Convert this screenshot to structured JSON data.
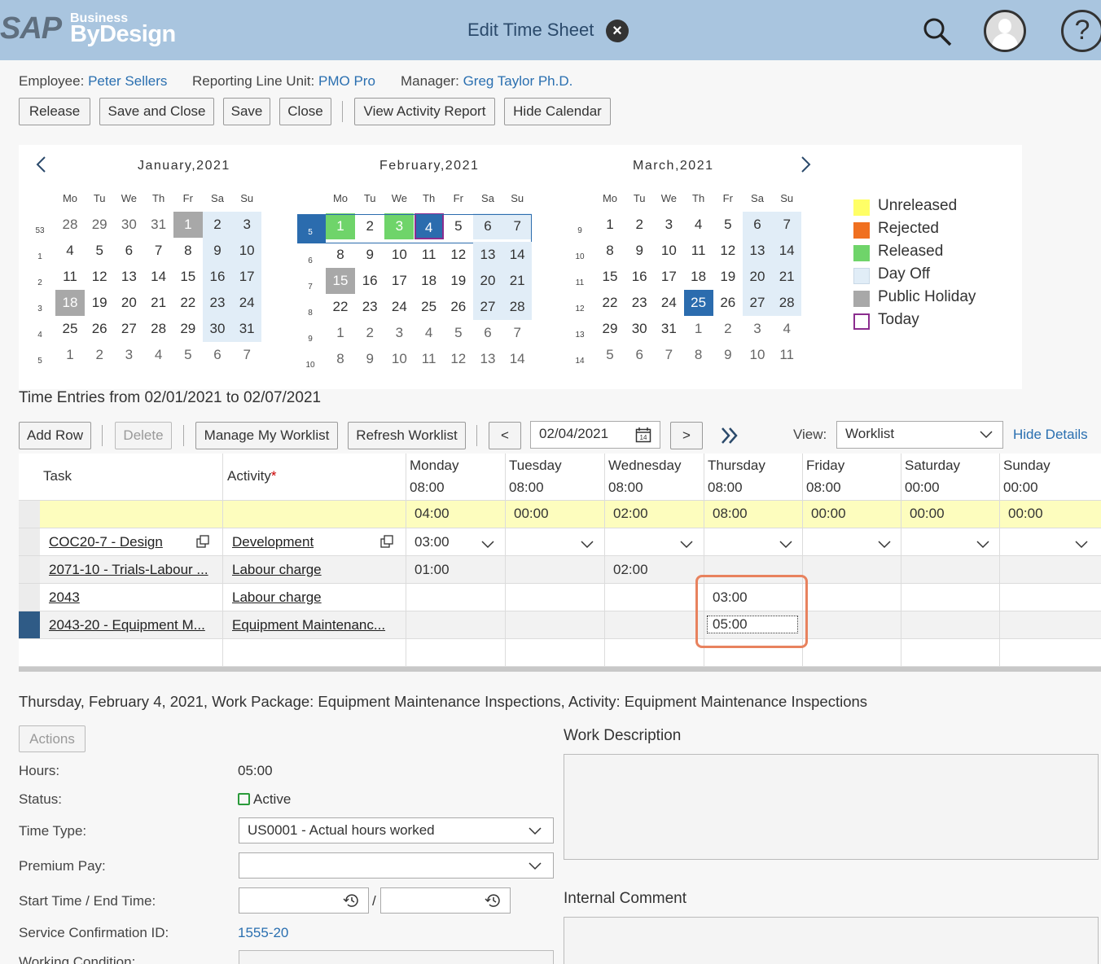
{
  "shell": {
    "logo_sap": "SAP",
    "logo_business": "Business",
    "logo_bydesign": "ByDesign",
    "title": "Edit Time Sheet",
    "close_icon": "×",
    "help_icon": "?"
  },
  "header": {
    "employee_label": "Employee:",
    "employee_value": "Peter Sellers",
    "rlu_label": "Reporting Line Unit:",
    "rlu_value": "PMO Pro",
    "manager_label": "Manager:",
    "manager_value": "Greg Taylor Ph.D."
  },
  "toolbar": {
    "release": "Release",
    "save_close": "Save and Close",
    "save": "Save",
    "close": "Close",
    "view_activity": "View Activity Report",
    "hide_calendar": "Hide Calendar"
  },
  "calendar": {
    "dow": [
      "Mo",
      "Tu",
      "We",
      "Th",
      "Fr",
      "Sa",
      "Su"
    ],
    "months": [
      {
        "title": "January,2021",
        "weeks": [
          "53",
          "1",
          "2",
          "3",
          "4",
          "5"
        ],
        "days": [
          [
            "28",
            "29",
            "30",
            "31",
            "1",
            "2",
            "3"
          ],
          [
            "4",
            "5",
            "6",
            "7",
            "8",
            "9",
            "10"
          ],
          [
            "11",
            "12",
            "13",
            "14",
            "15",
            "16",
            "17"
          ],
          [
            "18",
            "19",
            "20",
            "21",
            "22",
            "23",
            "24"
          ],
          [
            "25",
            "26",
            "27",
            "28",
            "29",
            "30",
            "31"
          ],
          [
            "1",
            "2",
            "3",
            "4",
            "5",
            "6",
            "7"
          ]
        ]
      },
      {
        "title": "February,2021",
        "weeks": [
          "5",
          "6",
          "7",
          "8",
          "9",
          "10"
        ],
        "days": [
          [
            "1",
            "2",
            "3",
            "4",
            "5",
            "6",
            "7"
          ],
          [
            "8",
            "9",
            "10",
            "11",
            "12",
            "13",
            "14"
          ],
          [
            "15",
            "16",
            "17",
            "18",
            "19",
            "20",
            "21"
          ],
          [
            "22",
            "23",
            "24",
            "25",
            "26",
            "27",
            "28"
          ],
          [
            "1",
            "2",
            "3",
            "4",
            "5",
            "6",
            "7"
          ],
          [
            "8",
            "9",
            "10",
            "11",
            "12",
            "13",
            "14"
          ]
        ]
      },
      {
        "title": "March,2021",
        "weeks": [
          "9",
          "10",
          "11",
          "12",
          "13",
          "14"
        ],
        "days": [
          [
            "1",
            "2",
            "3",
            "4",
            "5",
            "6",
            "7"
          ],
          [
            "8",
            "9",
            "10",
            "11",
            "12",
            "13",
            "14"
          ],
          [
            "15",
            "16",
            "17",
            "18",
            "19",
            "20",
            "21"
          ],
          [
            "22",
            "23",
            "24",
            "25",
            "26",
            "27",
            "28"
          ],
          [
            "29",
            "30",
            "31",
            "1",
            "2",
            "3",
            "4"
          ],
          [
            "5",
            "6",
            "7",
            "8",
            "9",
            "10",
            "11"
          ]
        ]
      }
    ],
    "legend": [
      {
        "label": "Unreleased",
        "color": "#ffff66"
      },
      {
        "label": "Rejected",
        "color": "#f07020"
      },
      {
        "label": "Released",
        "color": "#6fd46a"
      },
      {
        "label": "Day Off",
        "color": "#e1edf7"
      },
      {
        "label": "Public Holiday",
        "color": "#a8a8a8"
      },
      {
        "label": "Today",
        "color": "#8b2d8e"
      }
    ]
  },
  "entries": {
    "title": "Time Entries from 02/01/2021 to 02/07/2021",
    "add_row": "Add Row",
    "delete": "Delete",
    "manage_worklist": "Manage My Worklist",
    "refresh_worklist": "Refresh Worklist",
    "prev": "<",
    "date": "02/04/2021",
    "next": ">",
    "view_label": "View:",
    "view_value": "Worklist",
    "hide_details": "Hide Details",
    "col_task": "Task",
    "col_activity": "Activity",
    "required_mark": "*",
    "days": [
      {
        "name": "Monday",
        "hours": "08:00",
        "total": "04:00"
      },
      {
        "name": "Tuesday",
        "hours": "08:00",
        "total": "00:00"
      },
      {
        "name": "Wednesday",
        "hours": "08:00",
        "total": "02:00"
      },
      {
        "name": "Thursday",
        "hours": "08:00",
        "total": "08:00"
      },
      {
        "name": "Friday",
        "hours": "08:00",
        "total": "00:00"
      },
      {
        "name": "Saturday",
        "hours": "00:00",
        "total": "00:00"
      },
      {
        "name": "Sunday",
        "hours": "00:00",
        "total": "00:00"
      }
    ],
    "rows": [
      {
        "task": "COC20-7 - Design",
        "activity": "Development",
        "values": [
          "03:00",
          "",
          "",
          "",
          "",
          "",
          ""
        ]
      },
      {
        "task": "2071-10 - Trials-Labour ...",
        "activity": "Labour charge",
        "values": [
          "01:00",
          "",
          "02:00",
          "",
          "",
          "",
          ""
        ]
      },
      {
        "task": "2043",
        "activity": "Labour charge",
        "values": [
          "",
          "",
          "",
          "03:00",
          "",
          "",
          ""
        ]
      },
      {
        "task": "2043-20 - Equipment M...",
        "activity": "Equipment Maintenanc...",
        "values": [
          "",
          "",
          "",
          "05:00",
          "",
          "",
          ""
        ]
      }
    ]
  },
  "detail": {
    "title": "Thursday, February 4, 2021, Work Package: Equipment Maintenance Inspections, Activity: Equipment Maintenance Inspections",
    "actions": "Actions",
    "hours_label": "Hours:",
    "hours_value": "05:00",
    "status_label": "Status:",
    "status_value": "Active",
    "time_type_label": "Time Type:",
    "time_type_value": "US0001 - Actual hours worked",
    "premium_pay_label": "Premium Pay:",
    "start_end_label": "Start Time / End Time:",
    "slash": "/",
    "service_conf_label": "Service Confirmation ID:",
    "service_conf_value": "1555-20",
    "working_condition_label": "Working Condition:",
    "work_description_label": "Work Description",
    "internal_comment_label": "Internal Comment"
  }
}
